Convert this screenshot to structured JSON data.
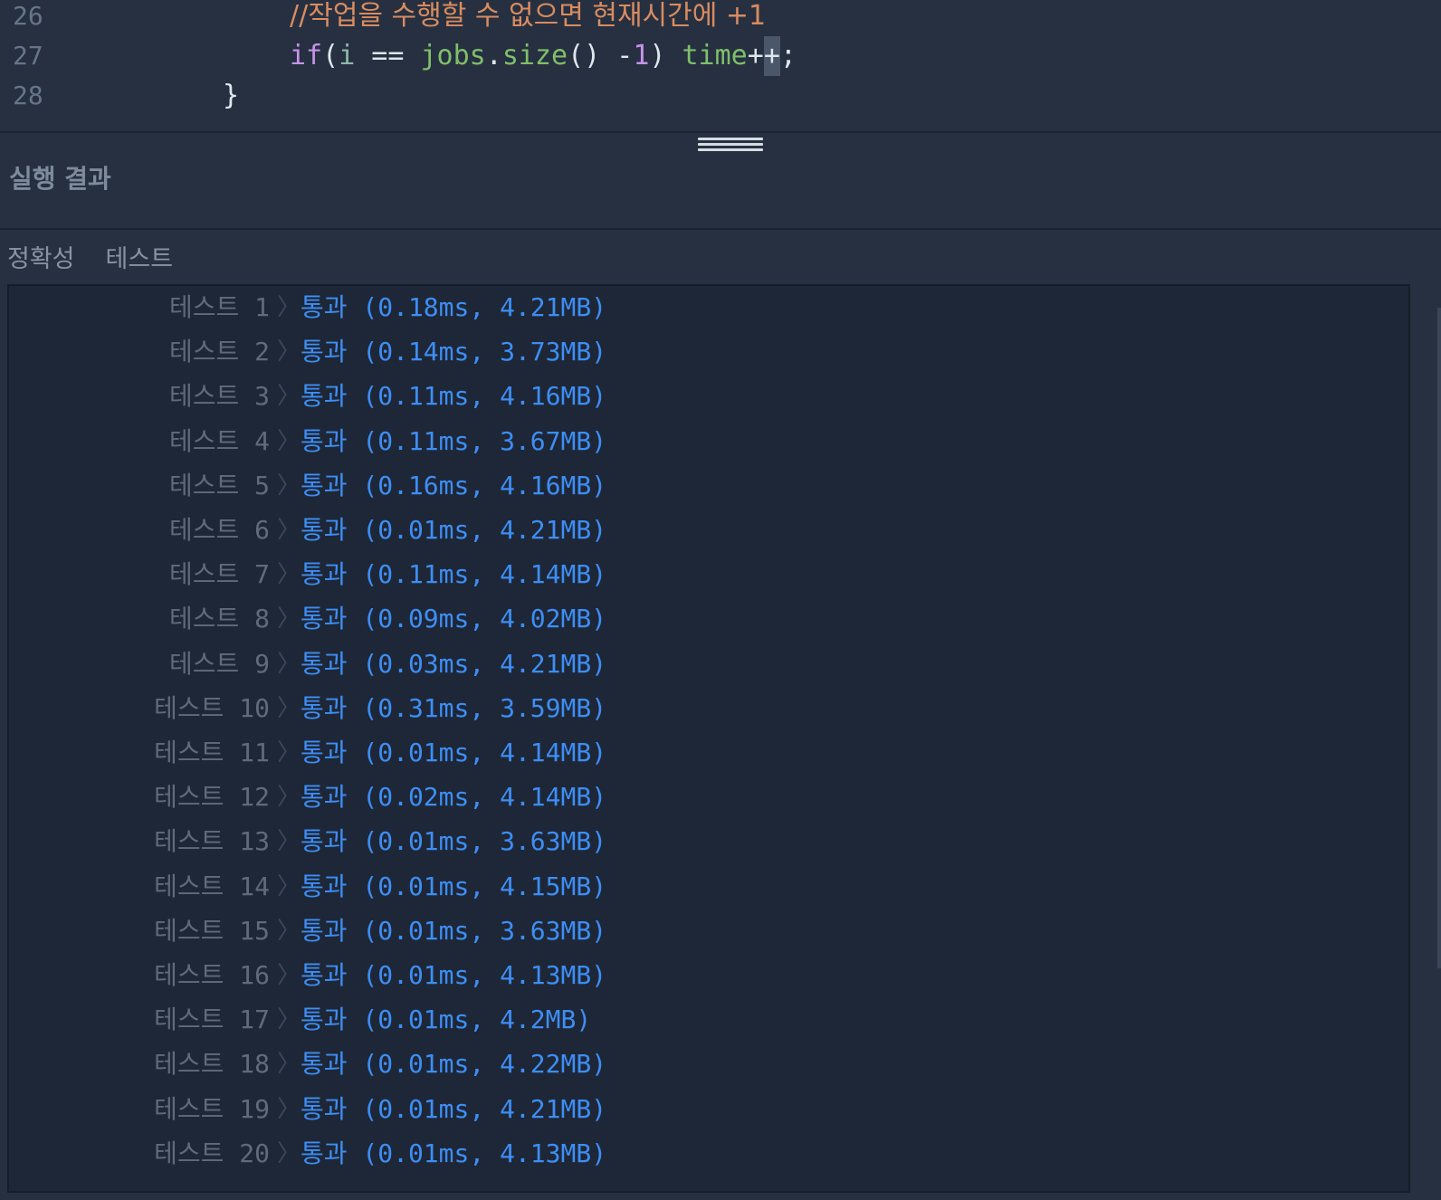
{
  "editor": {
    "lines": [
      {
        "number": "26",
        "indent": 320,
        "tokens": [
          {
            "t": "//작업을 수행할 수 없으면 현재시간에 +1",
            "c": "tok-comment"
          }
        ]
      },
      {
        "number": "27",
        "indent": 320,
        "tokens": [
          {
            "t": "if",
            "c": "tok-keyword"
          },
          {
            "t": "(",
            "c": "tok-punc"
          },
          {
            "t": "i",
            "c": "tok-var"
          },
          {
            "t": " == ",
            "c": "tok-op"
          },
          {
            "t": "jobs",
            "c": "tok-method"
          },
          {
            "t": ".",
            "c": "tok-punc"
          },
          {
            "t": "size",
            "c": "tok-method"
          },
          {
            "t": "() -",
            "c": "tok-punc"
          },
          {
            "t": "1",
            "c": "tok-num"
          },
          {
            "t": ") ",
            "c": "tok-punc"
          },
          {
            "t": "time",
            "c": "tok-method"
          },
          {
            "t": "+",
            "c": "tok-op"
          },
          {
            "t": "+",
            "c": "tok-op cursor-block"
          },
          {
            "t": ";",
            "c": "tok-punc"
          }
        ]
      },
      {
        "number": "28",
        "indent": 246,
        "tokens": [
          {
            "t": "}",
            "c": "tok-punc"
          }
        ]
      }
    ]
  },
  "results": {
    "header": "실행 결과",
    "section_title": "정확성",
    "section_subtitle": "테스트",
    "tests": [
      {
        "name": "테스트 1",
        "result": "통과 (0.18ms, 4.21MB)"
      },
      {
        "name": "테스트 2",
        "result": "통과 (0.14ms, 3.73MB)"
      },
      {
        "name": "테스트 3",
        "result": "통과 (0.11ms, 4.16MB)"
      },
      {
        "name": "테스트 4",
        "result": "통과 (0.11ms, 3.67MB)"
      },
      {
        "name": "테스트 5",
        "result": "통과 (0.16ms, 4.16MB)"
      },
      {
        "name": "테스트 6",
        "result": "통과 (0.01ms, 4.21MB)"
      },
      {
        "name": "테스트 7",
        "result": "통과 (0.11ms, 4.14MB)"
      },
      {
        "name": "테스트 8",
        "result": "통과 (0.09ms, 4.02MB)"
      },
      {
        "name": "테스트 9",
        "result": "통과 (0.03ms, 4.21MB)"
      },
      {
        "name": "테스트 10",
        "result": "통과 (0.31ms, 3.59MB)"
      },
      {
        "name": "테스트 11",
        "result": "통과 (0.01ms, 4.14MB)"
      },
      {
        "name": "테스트 12",
        "result": "통과 (0.02ms, 4.14MB)"
      },
      {
        "name": "테스트 13",
        "result": "통과 (0.01ms, 3.63MB)"
      },
      {
        "name": "테스트 14",
        "result": "통과 (0.01ms, 4.15MB)"
      },
      {
        "name": "테스트 15",
        "result": "통과 (0.01ms, 3.63MB)"
      },
      {
        "name": "테스트 16",
        "result": "통과 (0.01ms, 4.13MB)"
      },
      {
        "name": "테스트 17",
        "result": "통과 (0.01ms, 4.2MB)"
      },
      {
        "name": "테스트 18",
        "result": "통과 (0.01ms, 4.22MB)"
      },
      {
        "name": "테스트 19",
        "result": "통과 (0.01ms, 4.21MB)"
      },
      {
        "name": "테스트 20",
        "result": "통과 (0.01ms, 4.13MB)"
      }
    ],
    "chevron_icon": "chevron-right-icon",
    "pass_color": "#3d8ef5"
  }
}
